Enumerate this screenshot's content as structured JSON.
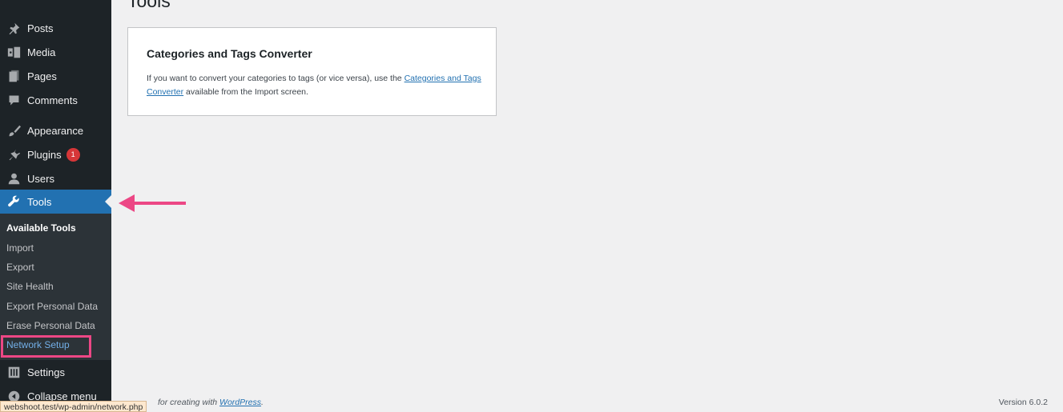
{
  "page": {
    "title": "Tools"
  },
  "sidebar": {
    "items": [
      {
        "label": "Posts",
        "icon": "pushpin-icon"
      },
      {
        "label": "Media",
        "icon": "media-icon"
      },
      {
        "label": "Pages",
        "icon": "pages-icon"
      },
      {
        "label": "Comments",
        "icon": "comment-icon"
      },
      {
        "label": "Appearance",
        "icon": "paintbrush-icon"
      },
      {
        "label": "Plugins",
        "icon": "plugin-icon",
        "badge": "1"
      },
      {
        "label": "Users",
        "icon": "user-icon"
      },
      {
        "label": "Tools",
        "icon": "wrench-icon",
        "active": true
      },
      {
        "label": "Settings",
        "icon": "settings-icon"
      },
      {
        "label": "Collapse menu",
        "icon": "collapse-icon"
      }
    ],
    "submenu": [
      {
        "label": "Available Tools",
        "current": true
      },
      {
        "label": "Import"
      },
      {
        "label": "Export"
      },
      {
        "label": "Site Health"
      },
      {
        "label": "Export Personal Data"
      },
      {
        "label": "Erase Personal Data"
      },
      {
        "label": "Network Setup",
        "highlighted": true
      }
    ]
  },
  "card": {
    "title": "Categories and Tags Converter",
    "text_before": "If you want to convert your categories to tags (or vice versa), use the ",
    "link": "Categories and Tags Converter",
    "text_after": " available from the Import screen."
  },
  "footer": {
    "thanks_visible": "for creating with ",
    "wp_link": "WordPress",
    "thanks_end": ".",
    "version": "Version 6.0.2"
  },
  "status_url": "webshoot.test/wp-admin/network.php",
  "colors": {
    "sidebar_bg": "#1d2327",
    "active_bg": "#2271b1",
    "annotation": "#ec4785",
    "badge": "#d63638"
  }
}
